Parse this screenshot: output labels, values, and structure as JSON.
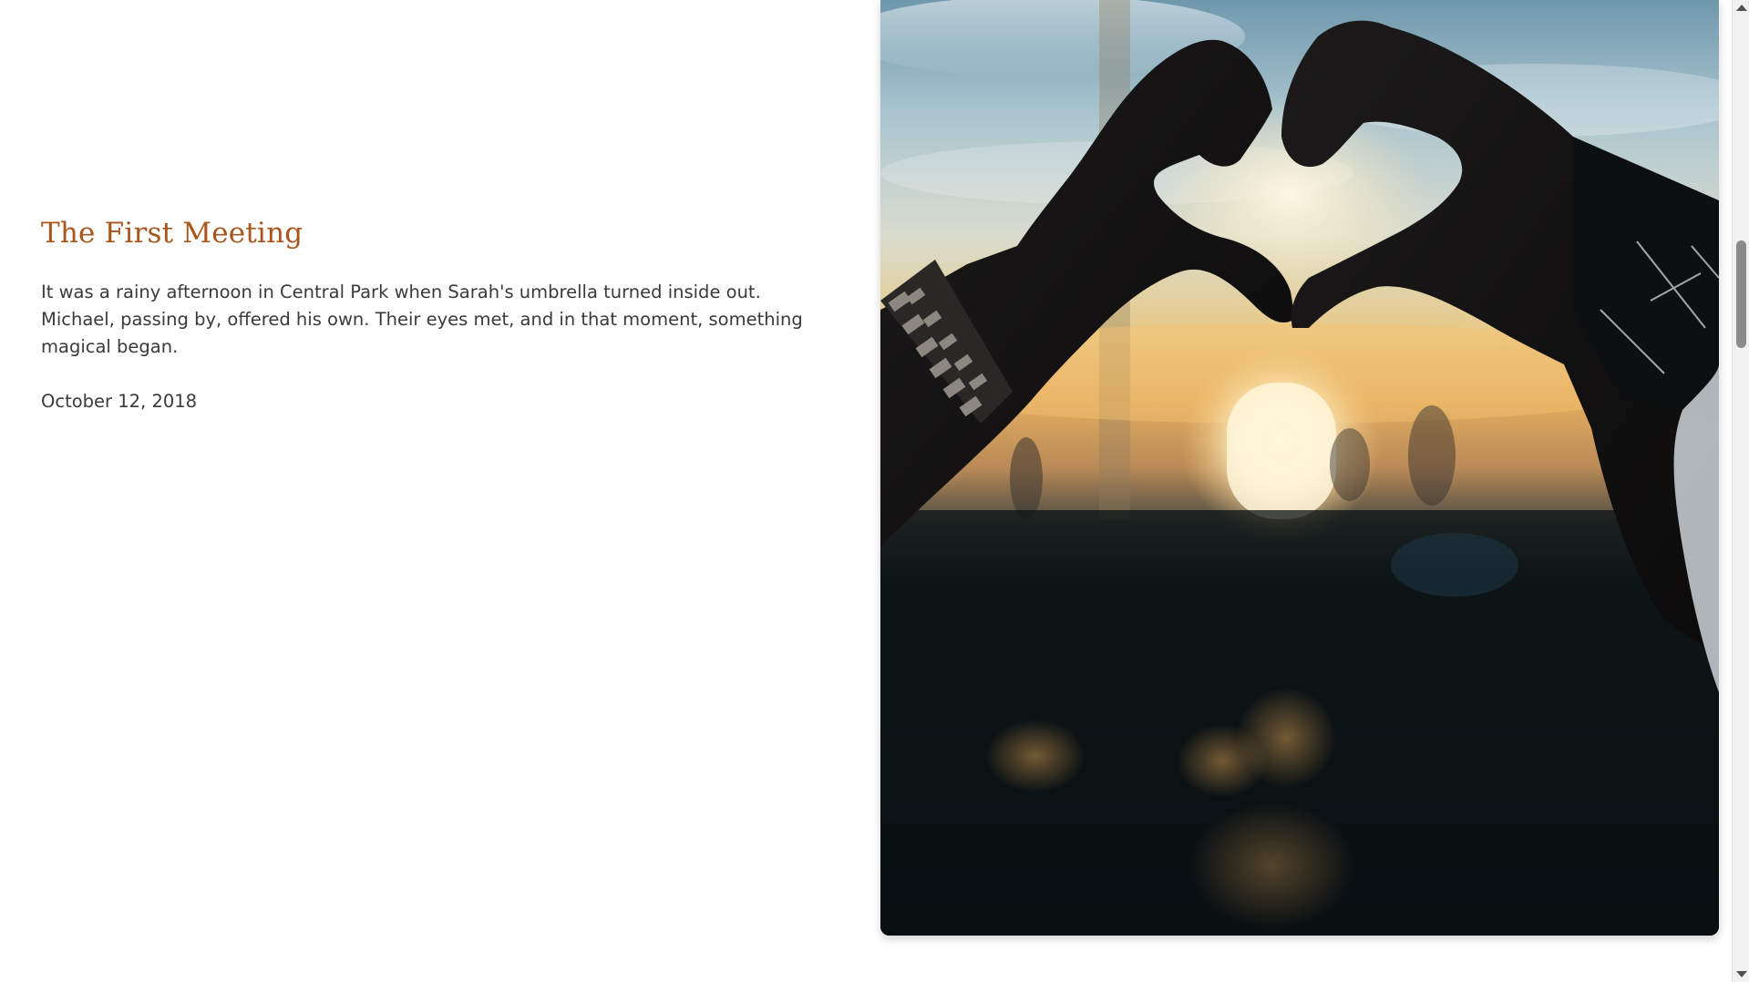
{
  "story": {
    "title": "The First Meeting",
    "body": "It was a rainy afternoon in Central Park when Sarah's umbrella turned inside out. Michael, passing by, offered his own. Their eyes met, and in that moment, something magical began.",
    "date": "October 12, 2018"
  },
  "photo": {
    "alt": "Two hands forming a heart shape silhouetted against a sunset"
  },
  "colors": {
    "title": "#a8561d",
    "text": "#3a3a3a"
  }
}
